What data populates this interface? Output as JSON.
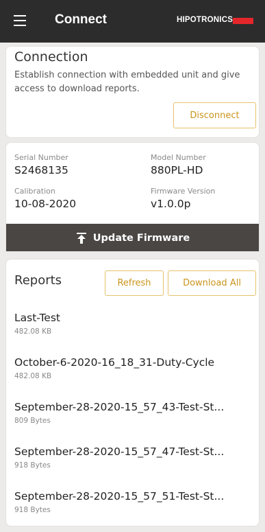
{
  "header": {
    "title": "Connect",
    "brand": "HIPOTRONICS",
    "brand_color": "#e4262b",
    "menu_icon": "hamburger-menu-icon"
  },
  "connection": {
    "title": "Connection",
    "description": "Establish connection with embedded unit and give access to download reports.",
    "disconnect_label": "Disconnect"
  },
  "device": {
    "serial_label": "Serial Number",
    "serial_value": "S2468135",
    "model_label": "Model Number",
    "model_value": "880PL-HD",
    "calibration_label": "Calibration",
    "calibration_value": "10-08-2020",
    "firmware_label": "Firmware Version",
    "firmware_value": "v1.0.0p",
    "update_label": "Update Firmware",
    "update_icon": "upload-arrow-icon"
  },
  "reports": {
    "title": "Reports",
    "refresh_label": "Refresh",
    "download_all_label": "Download All",
    "items": [
      {
        "name": "Last-Test",
        "size": "482.08 KB"
      },
      {
        "name": "October-6-2020-16_18_31-Duty-Cycle",
        "size": "482.08 KB"
      },
      {
        "name": "September-28-2020-15_57_43-Test-St...",
        "size": "809 Bytes"
      },
      {
        "name": "September-28-2020-15_57_47-Test-St...",
        "size": "918 Bytes"
      },
      {
        "name": "September-28-2020-15_57_51-Test-St...",
        "size": "918 Bytes"
      }
    ]
  },
  "colors": {
    "accent": "#c9941c",
    "accent_border": "#e6c26a",
    "topbar": "#2c2c2c",
    "update_bar": "#4a4644"
  }
}
